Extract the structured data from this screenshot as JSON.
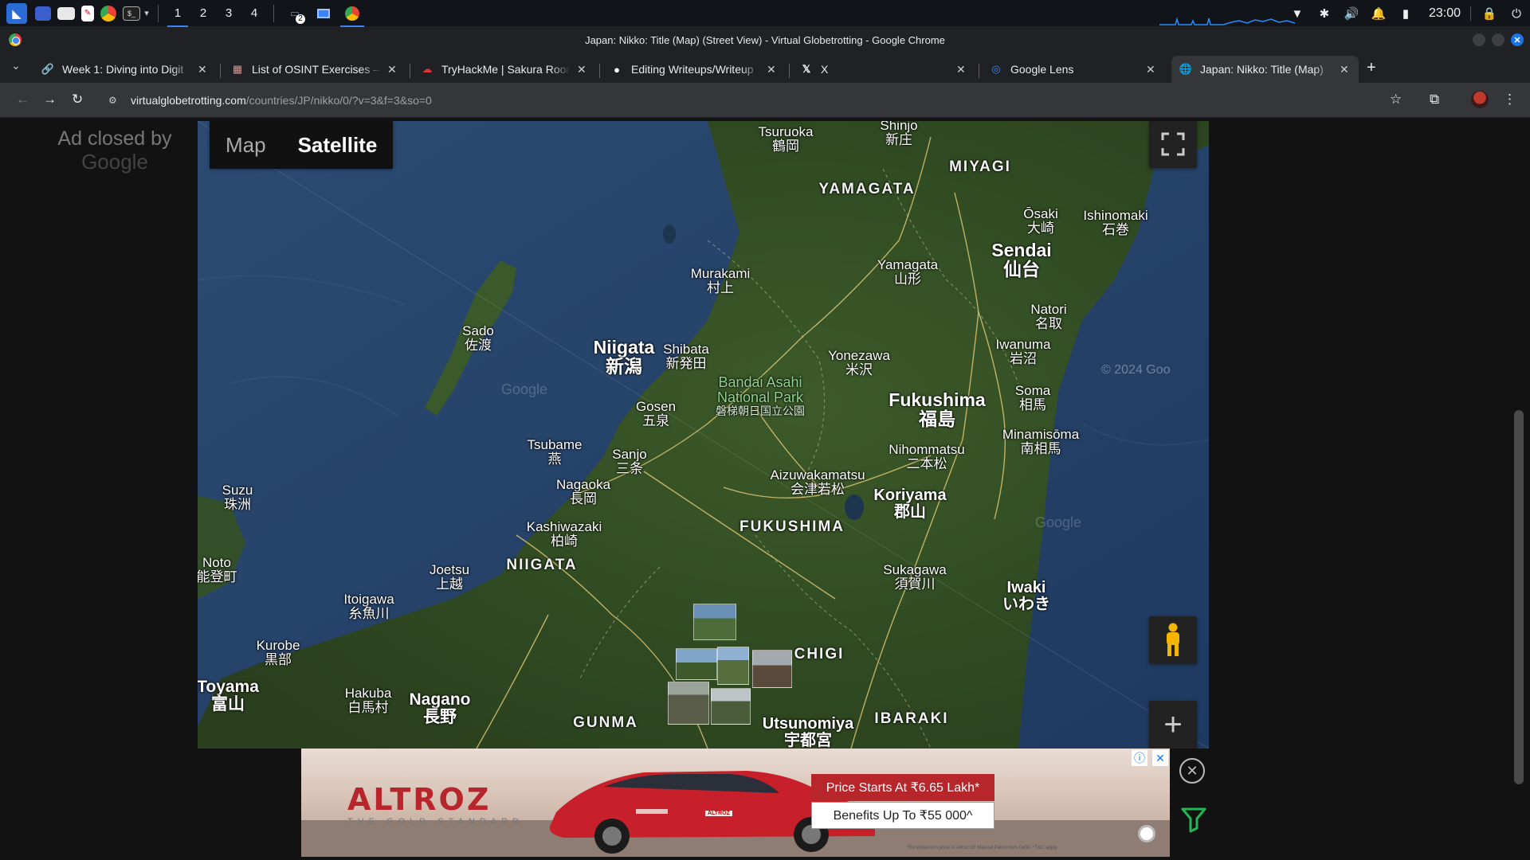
{
  "taskbar": {
    "workspaces": [
      "1",
      "2",
      "3",
      "4"
    ],
    "clock": "23:00",
    "running_badge": "2"
  },
  "window": {
    "title": "Japan: Nikko: Title (Map) (Street View) - Virtual Globetrotting - Google Chrome"
  },
  "tabs": [
    {
      "title": "Week 1: Diving into Digit",
      "icon": "link-icon"
    },
    {
      "title": "List of OSINT Exercises –",
      "icon": "osint-favicon"
    },
    {
      "title": "TryHackMe | Sakura Roon",
      "icon": "tryhackme-icon"
    },
    {
      "title": "Editing Writeups/Writeup",
      "icon": "github-icon"
    },
    {
      "title": "X",
      "icon": "x-icon"
    },
    {
      "title": "Google Lens",
      "icon": "google-lens-icon"
    },
    {
      "title": "Japan: Nikko: Title (Map)",
      "icon": "globe-icon",
      "active": true
    }
  ],
  "address": {
    "host": "virtualglobetrotting.com",
    "path": "/countries/JP/nikko/0/?v=3&f=3&so=0"
  },
  "sidebar_ad": {
    "line1": "Ad closed by",
    "line2": "Google"
  },
  "map": {
    "type_map": "Map",
    "type_satellite": "Satellite",
    "copyright": "© 2024 Goo",
    "watermark": "Google",
    "labels": [
      {
        "en": "Tsuruoka",
        "jp": "鶴岡"
      },
      {
        "en": "Shinjo",
        "jp": "新庄"
      },
      {
        "en": "YAMAGATA",
        "jp": ""
      },
      {
        "en": "MIYAGI",
        "jp": ""
      },
      {
        "en": "Ōsaki",
        "jp": "大崎"
      },
      {
        "en": "Ishinomaki",
        "jp": "石巻"
      },
      {
        "en": "Sendai",
        "jp": "仙台"
      },
      {
        "en": "Yamagata",
        "jp": "山形"
      },
      {
        "en": "Murakami",
        "jp": "村上"
      },
      {
        "en": "Natori",
        "jp": "名取"
      },
      {
        "en": "Sado",
        "jp": "佐渡"
      },
      {
        "en": "Niigata",
        "jp": "新潟"
      },
      {
        "en": "Shibata",
        "jp": "新発田"
      },
      {
        "en": "Yonezawa",
        "jp": "米沢"
      },
      {
        "en": "Iwanuma",
        "jp": "岩沼"
      },
      {
        "en": "Bandai Asahi National Park",
        "jp": "磐梯朝日国立公園"
      },
      {
        "en": "Fukushima",
        "jp": "福島"
      },
      {
        "en": "Soma",
        "jp": "相馬"
      },
      {
        "en": "Gosen",
        "jp": "五泉"
      },
      {
        "en": "Minamisōma",
        "jp": "南相馬"
      },
      {
        "en": "Tsubame",
        "jp": "燕"
      },
      {
        "en": "Sanjo",
        "jp": "三条"
      },
      {
        "en": "Nihommatsu",
        "jp": "二本松"
      },
      {
        "en": "Aizuwakamatsu",
        "jp": "会津若松"
      },
      {
        "en": "Suzu",
        "jp": "珠洲"
      },
      {
        "en": "Nagaoka",
        "jp": "長岡"
      },
      {
        "en": "Koriyama",
        "jp": "郡山"
      },
      {
        "en": "Kashiwazaki",
        "jp": "柏崎"
      },
      {
        "en": "FUKUSHIMA",
        "jp": ""
      },
      {
        "en": "Noto",
        "jp": "能登町"
      },
      {
        "en": "NIIGATA",
        "jp": ""
      },
      {
        "en": "Joetsu",
        "jp": "上越"
      },
      {
        "en": "Sukagawa",
        "jp": "須賀川"
      },
      {
        "en": "Iwaki",
        "jp": "いわき"
      },
      {
        "en": "Itoigawa",
        "jp": "糸魚川"
      },
      {
        "en": "Kurobe",
        "jp": "黒部"
      },
      {
        "en": "CHIGI",
        "jp": ""
      },
      {
        "en": "Toyama",
        "jp": "富山"
      },
      {
        "en": "Hakuba",
        "jp": "白馬村"
      },
      {
        "en": "Nagano",
        "jp": "長野"
      },
      {
        "en": "GUNMA",
        "jp": ""
      },
      {
        "en": "Utsunomiya",
        "jp": "宇都宮"
      },
      {
        "en": "IBARAKI",
        "jp": ""
      }
    ]
  },
  "bottom_ad": {
    "brand": "ALTROZ",
    "tagline": "THE GOLD STANDARD",
    "badge": "ALTROZ",
    "price": "Price Starts At ₹6.65 Lakh*",
    "benefit": "Benefits Up To ₹55 000^",
    "fine_print": "*Ex-showroom price of Altroz XE Manual Petrol from Delhi. ^T&C apply"
  }
}
